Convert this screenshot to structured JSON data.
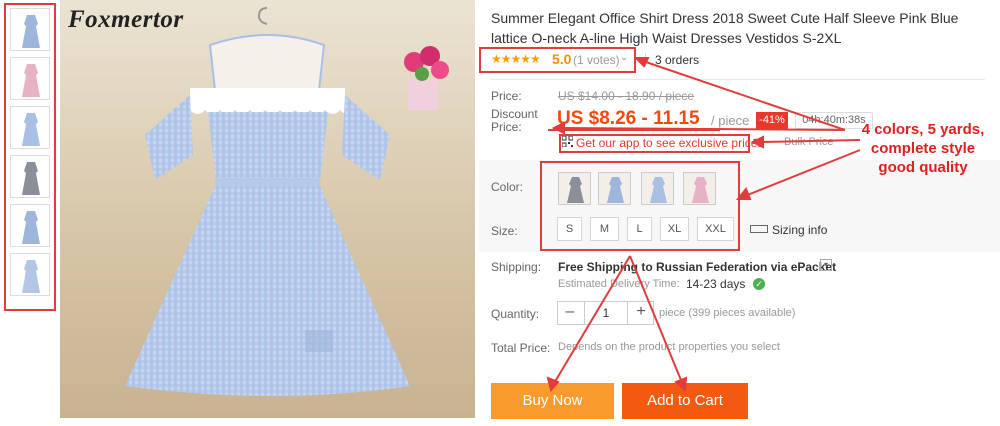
{
  "brand": "Foxmertor",
  "product": {
    "title": "Summer Elegant Office Shirt Dress 2018 Sweet Cute Half Sleeve Pink Blue lattice O-neck A-line High Waist Dresses Vestidos S-2XL",
    "stars": "★★★★★",
    "rating": "5.0",
    "votes": "(1 votes)",
    "orders": "3 orders"
  },
  "price": {
    "label": "Price:",
    "original": "US $14.00 - 18.90 / piece",
    "discount_label_1": "Discount",
    "discount_label_2": "Price:",
    "discount": "US $8.26 - 11.15",
    "per_piece": "/ piece",
    "off_badge": "-41%",
    "timer": "04h:40m:38s",
    "app_link": "Get our app to see exclusive prices",
    "bulk": "Bulk Price"
  },
  "options": {
    "color_label": "Color:",
    "colors": [
      "gray",
      "blue",
      "blue",
      "pink"
    ],
    "color_hex": [
      "#8a8f9a",
      "#9fb6dc",
      "#a9bfe3",
      "#e8b2c6"
    ],
    "size_label": "Size:",
    "sizes": [
      "S",
      "M",
      "L",
      "XL",
      "XXL"
    ],
    "sizing_info": "Sizing info"
  },
  "shipping": {
    "label": "Shipping:",
    "text": "Free Shipping to Russian Federation via ePacket",
    "delivery_label": "Estimated Delivery Time:",
    "delivery_value": "14-23 days"
  },
  "quantity": {
    "label": "Quantity:",
    "value": "1",
    "note": "piece (399 pieces available)"
  },
  "total": {
    "label": "Total Price:",
    "note": "Depends on the product properties you select"
  },
  "buttons": {
    "buy_now": "Buy Now",
    "add_to_cart": "Add to Cart"
  },
  "annotation": {
    "line1": "4 colors, 5 yards,",
    "line2": "complete style",
    "line3": "good quality"
  },
  "thumbnails": [
    "blue",
    "pink",
    "blue",
    "gray",
    "blue",
    "blue"
  ],
  "thumb_hex": [
    "#9fb6dc",
    "#e8b2c6",
    "#a9bfe3",
    "#8a8f9a",
    "#9fb6dc",
    "#b3c6e6"
  ]
}
